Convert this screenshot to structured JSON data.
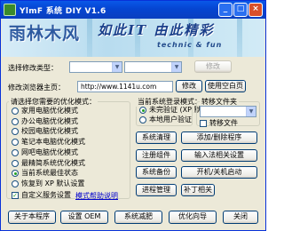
{
  "window": {
    "title": "YlmF 系统 DIY V1.6"
  },
  "banner": {
    "logo_text": "雨林木风",
    "slogan": "如此IT 由此精彩",
    "subtitle": "technic & fun"
  },
  "row1": {
    "label": "选择修改类型：",
    "select_value": "",
    "button": "修改"
  },
  "row2": {
    "label": "修改浏览器主页：",
    "homepage_value": "http://www.1141u.com",
    "modify_button": "修改",
    "blank_button": "使用空白页"
  },
  "optimize": {
    "title": "请选择您需要的优化模式：",
    "options": [
      "家用电脑优化模式",
      "办公电脑优化模式",
      "校园电脑优化模式",
      "笔记本电脑优化模式",
      "网吧电脑优化模式",
      "最精简系统优化模式",
      "当前系统最佳状态",
      "恢复到 XP 默认设置"
    ],
    "selected_index": 6,
    "custom_services_label": "自定义服务设置",
    "mode_help_link": "模式帮助说明"
  },
  "login": {
    "title": "当前系统登录模式：",
    "options": [
      "未完验证 (XP 默认)",
      "本地用户验证"
    ],
    "selected_index": 0
  },
  "skin": {
    "title": "转移文件夹",
    "label": "转移文件"
  },
  "tools": {
    "left": [
      "系统清理",
      "注册组件",
      "系统备份",
      "进程管理"
    ],
    "right": [
      "添加/删除程序",
      "输入法相关设置",
      "开机/关机启动",
      "补丁相关"
    ]
  },
  "bottom": {
    "buttons": [
      "关于本程序",
      "设置 OEM",
      "系统减肥",
      "优化向导",
      "关闭"
    ]
  },
  "colors": {
    "titlebar": "#0a58e8",
    "face": "#ece9d8",
    "link": "#0000cc"
  }
}
